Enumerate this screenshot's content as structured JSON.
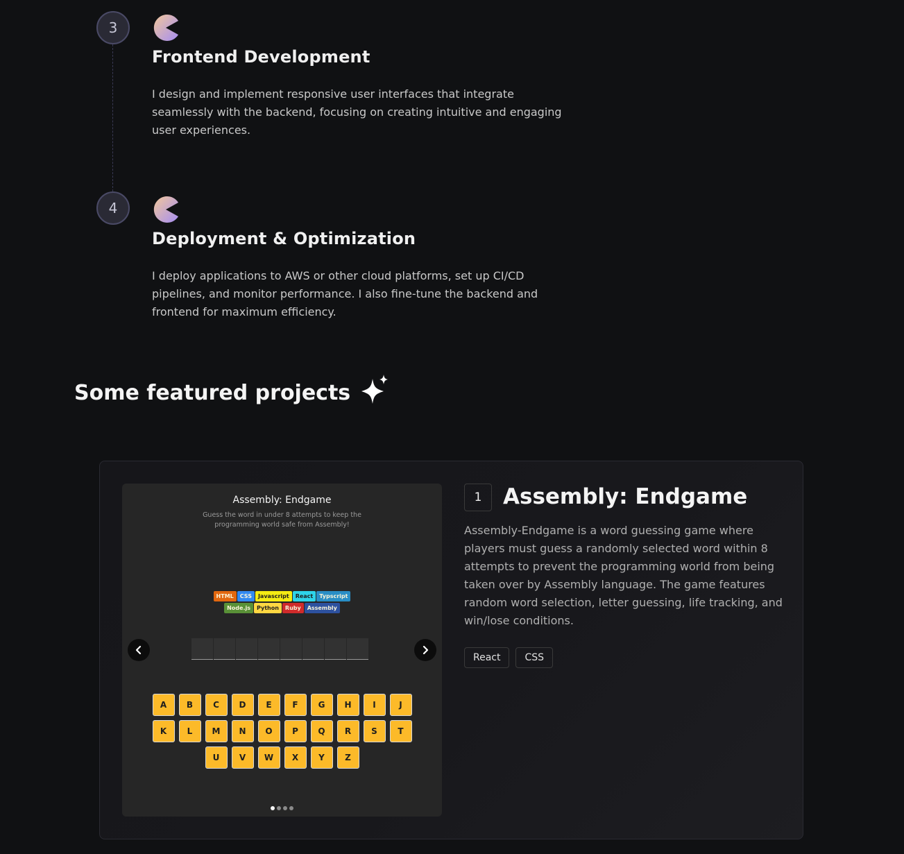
{
  "steps": [
    {
      "number": "3",
      "title": "Frontend Development",
      "description": "I design and implement responsive user interfaces that integrate seamlessly with the backend, focusing on creating intuitive and engaging user experiences."
    },
    {
      "number": "4",
      "title": "Deployment & Optimization",
      "description": "I deploy applications to AWS or other cloud platforms, set up CI/CD pipelines, and monitor performance. I also fine-tune the backend and frontend for maximum efficiency."
    }
  ],
  "featured": {
    "title": "Some featured projects",
    "icon": "sparkle-icon"
  },
  "project": {
    "number": "1",
    "title": "Assembly: Endgame",
    "description": "Assembly-Endgame is a word guessing game where players must guess a randomly selected word within 8 attempts to prevent the programming world from being taken over by Assembly language. The game features random word selection, letter guessing, life tracking, and win/lose conditions.",
    "tags": [
      "React",
      "CSS"
    ],
    "preview": {
      "title": "Assembly: Endgame",
      "subtitle": "Guess the word in under 8 attempts to keep the programming world safe from Assembly!",
      "languages_row1": [
        {
          "name": "HTML",
          "bg": "#E2680F",
          "fg": "#F9F4DA"
        },
        {
          "name": "CSS",
          "bg": "#328AF1",
          "fg": "#F9F4DA"
        },
        {
          "name": "Javascript",
          "bg": "#F4EB13",
          "fg": "#1E1E1E"
        },
        {
          "name": "React",
          "bg": "#2ED3E9",
          "fg": "#1E1E1E"
        },
        {
          "name": "Typscript",
          "bg": "#298EC6",
          "fg": "#F9F4DA"
        }
      ],
      "languages_row2": [
        {
          "name": "Node.js",
          "bg": "#599137",
          "fg": "#F9F4DA"
        },
        {
          "name": "Python",
          "bg": "#FFD742",
          "fg": "#1E1E1E"
        },
        {
          "name": "Ruby",
          "bg": "#D02B2B",
          "fg": "#F9F4DA"
        },
        {
          "name": "Assembly",
          "bg": "#2D519F",
          "fg": "#F9F4DA"
        }
      ],
      "letter_slots": 8,
      "keyboard_rows": [
        [
          "A",
          "B",
          "C",
          "D",
          "E",
          "F",
          "G",
          "H",
          "I",
          "J"
        ],
        [
          "K",
          "L",
          "M",
          "N",
          "O",
          "P",
          "Q",
          "R",
          "S",
          "T"
        ],
        [
          "U",
          "V",
          "W",
          "X",
          "Y",
          "Z"
        ]
      ],
      "slides": 4,
      "active_slide": 1,
      "prev_icon": "chevron-left-icon",
      "next_icon": "chevron-right-icon"
    }
  }
}
